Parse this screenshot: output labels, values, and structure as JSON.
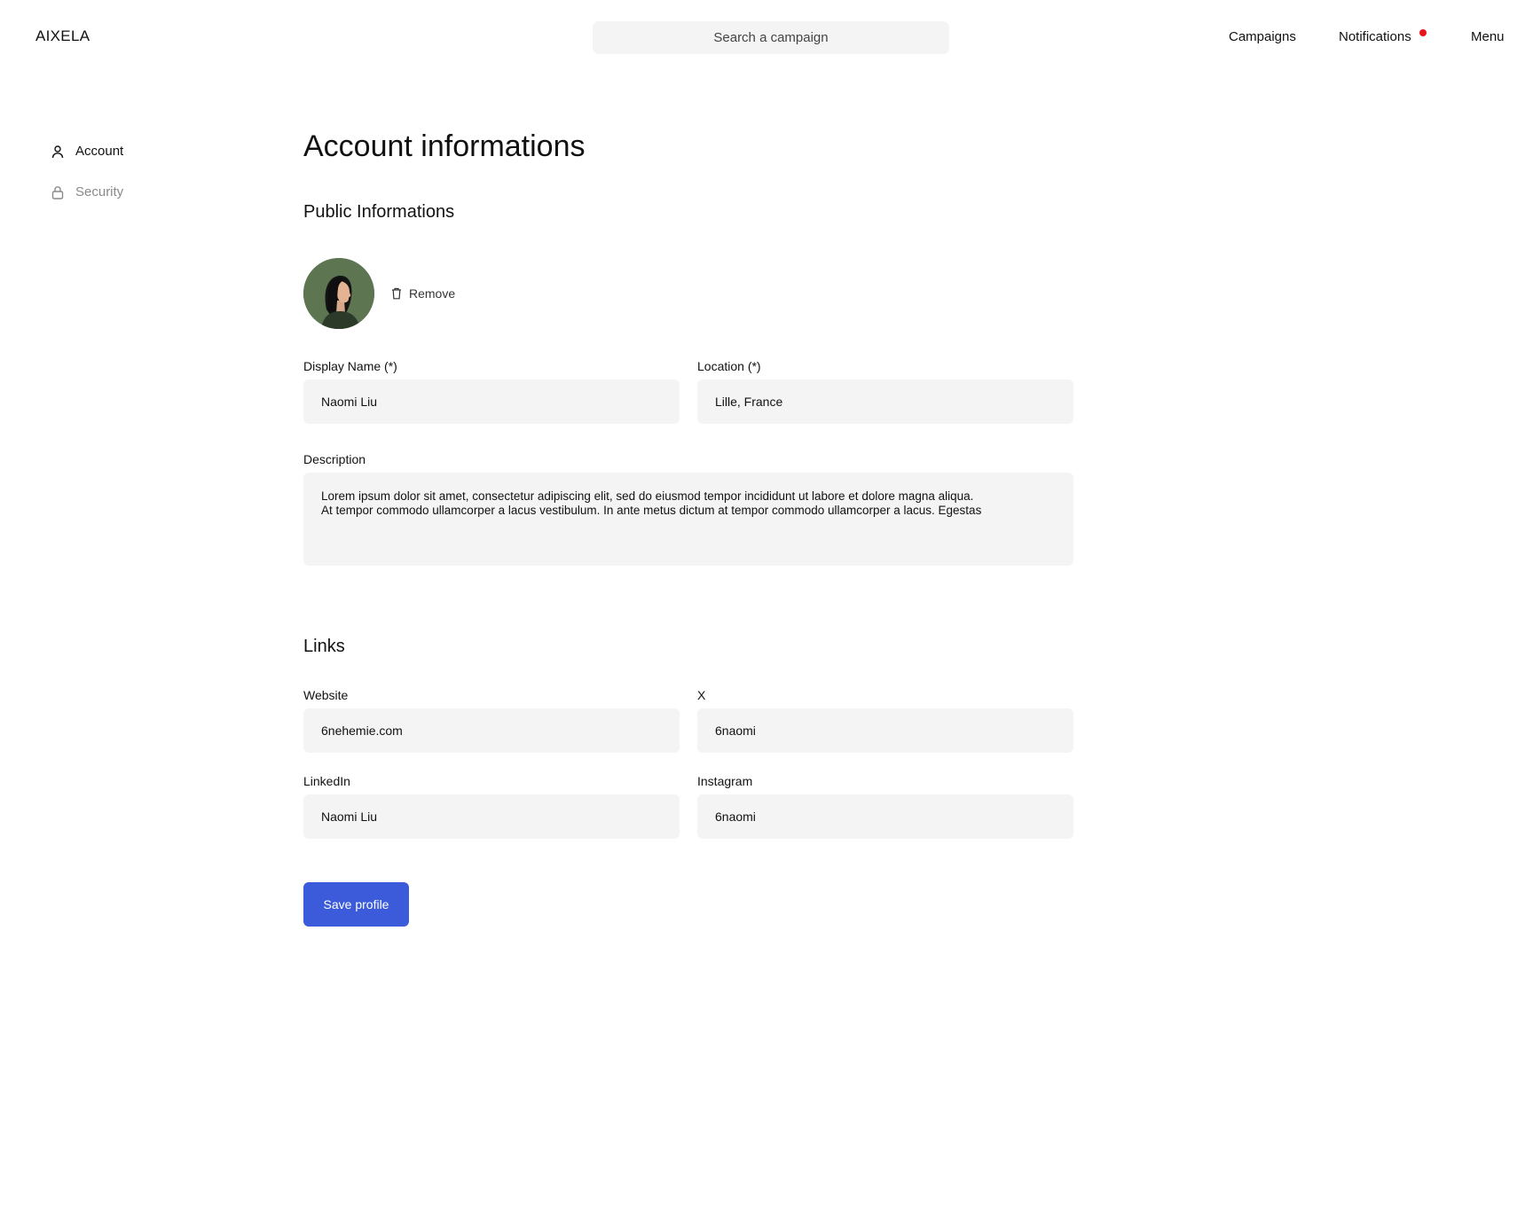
{
  "header": {
    "logo": "AIXELA",
    "search_placeholder": "Search a campaign",
    "nav": {
      "campaigns": "Campaigns",
      "notifications": "Notifications",
      "menu": "Menu"
    },
    "notification_dot_color": "#e8141b"
  },
  "sidebar": {
    "items": [
      {
        "label": "Account",
        "icon": "user-icon",
        "active": true
      },
      {
        "label": "Security",
        "icon": "lock-icon",
        "active": false
      }
    ]
  },
  "main": {
    "title": "Account informations",
    "public_section_title": "Public Informations",
    "remove_label": "Remove",
    "fields": {
      "display_name": {
        "label": "Display Name (*)",
        "value": "Naomi Liu"
      },
      "location": {
        "label": "Location (*)",
        "value": "Lille, France"
      },
      "description": {
        "label": "Description",
        "value": "Lorem ipsum dolor sit amet, consectetur adipiscing elit, sed do eiusmod tempor incididunt ut labore et dolore magna aliqua.\nAt tempor commodo ullamcorper a lacus vestibulum. In ante metus dictum at tempor commodo ullamcorper a lacus. Egestas"
      }
    },
    "links_section_title": "Links",
    "links": {
      "website": {
        "label": "Website",
        "value": "6nehemie.com"
      },
      "x": {
        "label": "X",
        "value": "6naomi"
      },
      "linkedin": {
        "label": "LinkedIn",
        "value": "Naomi Liu"
      },
      "instagram": {
        "label": "Instagram",
        "value": "6naomi"
      }
    },
    "save_label": "Save profile"
  },
  "colors": {
    "accent": "#3b5bdb",
    "field_background": "#f4f4f4",
    "avatar_background": "#5e7552"
  }
}
